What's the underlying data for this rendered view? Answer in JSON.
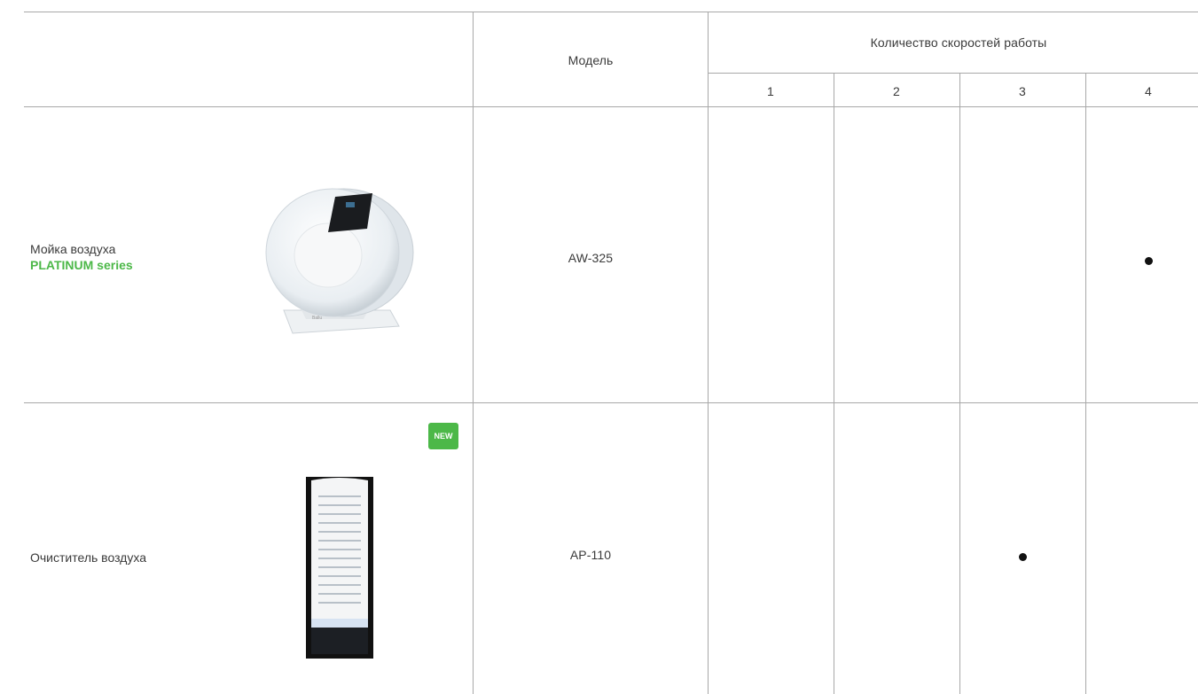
{
  "table": {
    "model_header": "Модель",
    "speeds_header": "Количество скоростей работы",
    "speed_columns": [
      "1",
      "2",
      "3",
      "4"
    ],
    "rows": [
      {
        "product_name": "Мойка воздуха",
        "series": "PLATINUM series",
        "model": "AW-325",
        "speed": 4,
        "badge": ""
      },
      {
        "product_name": "Очиститель воздуха",
        "series": "",
        "model": "AP-110",
        "speed": 3,
        "badge": "NEW"
      }
    ]
  },
  "colors": {
    "accent_green": "#4cb848",
    "grid_line": "#a8a8a8",
    "text": "#3a3a3a"
  }
}
